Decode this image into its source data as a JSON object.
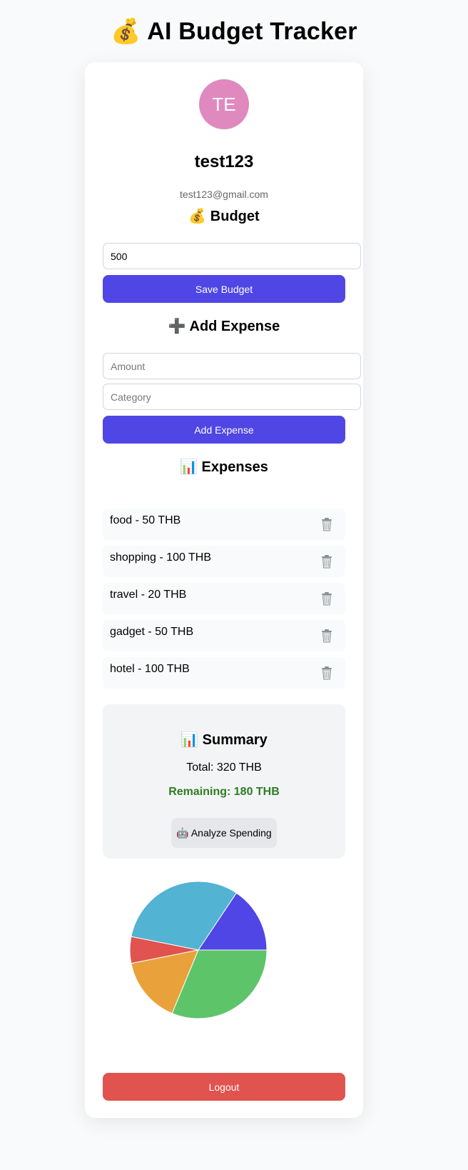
{
  "app": {
    "title": "💰 AI Budget Tracker"
  },
  "profile": {
    "initials": "TE",
    "username": "test123",
    "email": "test123@gmail.com",
    "avatar_color": "#e089bf"
  },
  "budget": {
    "title": "💰 Budget",
    "value": "500",
    "save_label": "Save Budget"
  },
  "add_expense": {
    "title": "➕ Add Expense",
    "amount_placeholder": "Amount",
    "category_placeholder": "Category",
    "button_label": "Add Expense"
  },
  "expenses": {
    "title": "📊 Expenses",
    "delete_icon": "trash-icon",
    "items": [
      {
        "label": "food - 50 THB"
      },
      {
        "label": "shopping - 100 THB"
      },
      {
        "label": "travel - 20 THB"
      },
      {
        "label": "gadget - 50 THB"
      },
      {
        "label": "hotel - 100 THB"
      }
    ]
  },
  "summary": {
    "title": "📊 Summary",
    "total": "Total: 320 THB",
    "remaining": "Remaining: 180 THB",
    "remaining_color": "#2e7d22",
    "analyze_label": "🤖 Analyze Spending"
  },
  "chart_data": {
    "type": "pie",
    "categories": [
      "food",
      "shopping",
      "travel",
      "gadget",
      "hotel"
    ],
    "values": [
      50,
      100,
      20,
      50,
      100
    ],
    "colors": [
      "#4f46e5",
      "#52b3d3",
      "#e0534e",
      "#e9a23b",
      "#5ec46a"
    ]
  },
  "logout": {
    "label": "Logout"
  },
  "colors": {
    "primary": "#4f46e5",
    "danger": "#e0534e"
  }
}
